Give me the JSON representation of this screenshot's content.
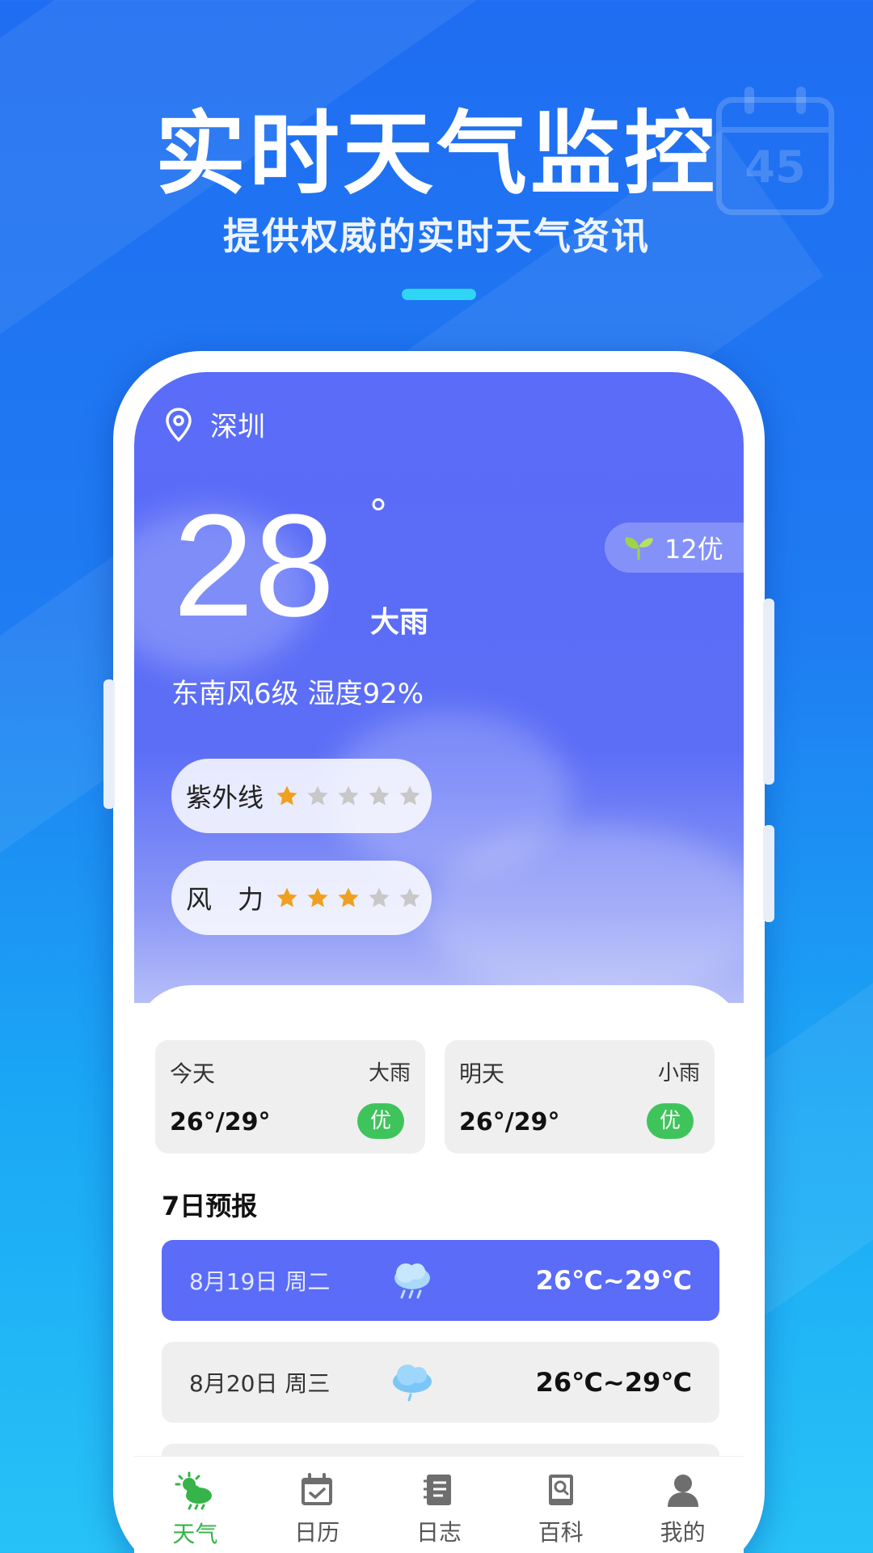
{
  "hero": {
    "title": "实时天气监控",
    "subtitle": "提供权威的实时天气资讯",
    "calendar_number": "45"
  },
  "weather": {
    "city": "深圳",
    "temperature": "28",
    "degree_symbol": "°",
    "condition": "大雨",
    "aqi_label": "12优",
    "wind_humidity": "东南风6级  湿度92%",
    "indices": [
      {
        "label": "紫外线",
        "stars_filled": 1,
        "stars_total": 5
      },
      {
        "label": "风　力",
        "stars_filled": 3,
        "stars_total": 5
      }
    ]
  },
  "days": [
    {
      "name": "今天",
      "condition": "大雨",
      "range": "26°/29°",
      "quality": "优"
    },
    {
      "name": "明天",
      "condition": "小雨",
      "range": "26°/29°",
      "quality": "优"
    }
  ],
  "forecast": {
    "title": "7日预报",
    "rows": [
      {
        "date": "8月19日 周二",
        "icon": "rain-cloud-icon",
        "range": "26℃~29℃",
        "highlighted": true
      },
      {
        "date": "8月20日 周三",
        "icon": "light-rain-cloud-icon",
        "range": "26℃~29℃",
        "highlighted": false
      }
    ]
  },
  "tabs": [
    {
      "label": "天气",
      "icon": "weather-icon",
      "active": true
    },
    {
      "label": "日历",
      "icon": "calendar-icon",
      "active": false
    },
    {
      "label": "日志",
      "icon": "notebook-icon",
      "active": false
    },
    {
      "label": "百科",
      "icon": "encyclopedia-icon",
      "active": false
    },
    {
      "label": "我的",
      "icon": "profile-icon",
      "active": false
    }
  ],
  "colors": {
    "accent": "#5a6cf8",
    "quality_green": "#3fc45c",
    "tab_active": "#34b449",
    "star_filled": "#f0a020",
    "star_empty": "#c8c8c8"
  }
}
